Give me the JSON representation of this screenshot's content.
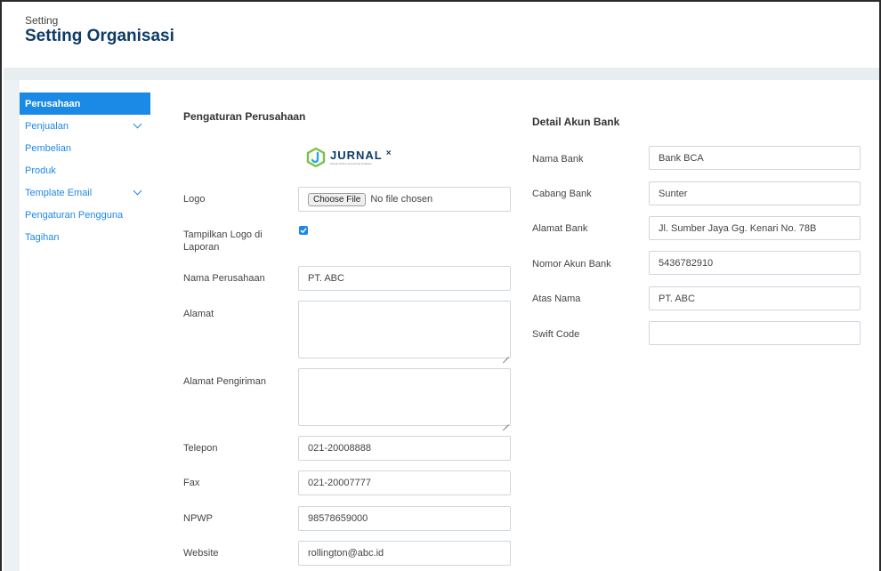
{
  "header": {
    "breadcrumb": "Setting",
    "title": "Setting Organisasi"
  },
  "sidebar": {
    "items": [
      {
        "label": "Perusahaan",
        "active": true,
        "has_chevron": false
      },
      {
        "label": "Penjualan",
        "active": false,
        "has_chevron": true
      },
      {
        "label": "Pembelian",
        "active": false,
        "has_chevron": false
      },
      {
        "label": "Produk",
        "active": false,
        "has_chevron": false
      },
      {
        "label": "Template Email",
        "active": false,
        "has_chevron": true
      },
      {
        "label": "Pengaturan Pengguna",
        "active": false,
        "has_chevron": false
      },
      {
        "label": "Tagihan",
        "active": false,
        "has_chevron": false
      }
    ]
  },
  "company": {
    "section_title": "Pengaturan Perusahaan",
    "logo_text": "JURNAL",
    "logo_x": "×",
    "logo_tagline": "Simple Online Accounting Software",
    "logo_label": "Logo",
    "file_button": "Choose File",
    "file_status": "No file chosen",
    "show_logo_label": "Tampilkan Logo di Laporan",
    "show_logo_checked": true,
    "name_label": "Nama Perusahaan",
    "name_value": "PT. ABC",
    "address_label": "Alamat",
    "address_value": "",
    "shipping_label": "Alamat Pengiriman",
    "shipping_value": "",
    "phone_label": "Telepon",
    "phone_value": "021-20008888",
    "fax_label": "Fax",
    "fax_value": "021-20007777",
    "npwp_label": "NPWP",
    "npwp_value": "98578659000",
    "website_label": "Website",
    "website_value": "rollington@abc.id"
  },
  "bank": {
    "section_title": "Detail Akun Bank",
    "bank_name_label": "Nama Bank",
    "bank_name_value": "Bank BCA",
    "branch_label": "Cabang Bank",
    "branch_value": "Sunter",
    "address_label": "Alamat Bank",
    "address_value": "Jl. Sumber Jaya Gg. Kenari No. 78B",
    "account_label": "Nomor Akun Bank",
    "account_value": "5436782910",
    "holder_label": "Atas Nama",
    "holder_value": "PT. ABC",
    "swift_label": "Swift Code",
    "swift_value": ""
  },
  "colors": {
    "accent": "#1b8ae6",
    "title": "#0d3b66",
    "logo_green": "#7cc242"
  }
}
